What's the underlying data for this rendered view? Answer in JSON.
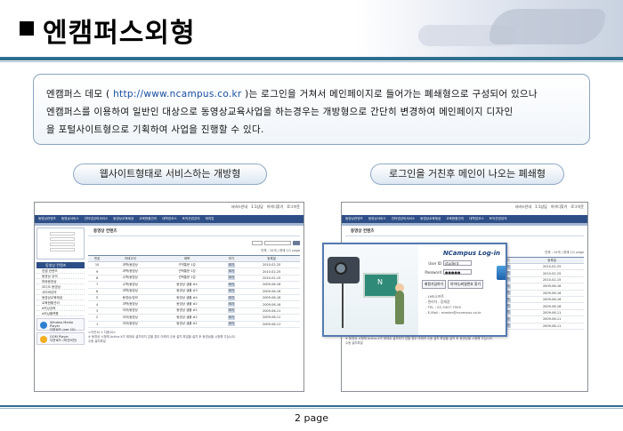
{
  "title": "엔캠퍼스외형",
  "description": {
    "line1_prefix": "엔캠퍼스 데모 ( ",
    "url": "http://www.ncampus.co.kr",
    "line1_suffix": " )는 로그인을 거쳐서 메인페이지로 들어가는 폐쇄형으로 구성되어 있으나",
    "line2": "엔캠퍼스를 이용하여 일반인 대상으로 동영상교육사업을 하는경우는 개방형으로 간단히 변경하여 메인페이지 디자인",
    "line3": "을 포털사이트형으로 기획하여 사업을 진행할 수 있다."
  },
  "labels": {
    "open_type": "웹사이트형태로 서비스하는 개방형",
    "closed_type": "로그인을 거친후 메인이 나오는 폐쇄형"
  },
  "mini_site": {
    "topbar": [
      "서비스안내",
      "1:1상담",
      "아이디찾기",
      "로그아웃"
    ],
    "gnb": [
      "동영상컨텐츠",
      "동영상서비스",
      "인터넷강의서비스",
      "동영상교육제공",
      "교육현황관리",
      "대학업코스",
      "토익관련강의",
      "캐치업"
    ],
    "menu_title": "동영상 컨텐츠",
    "content_title": "동영상 컨텐츠",
    "count_text": "전체 : 10개 | 현재 1/1 page",
    "menu_items": [
      "컨셉 컨텐츠",
      "동영상 강의",
      "파워동영상",
      "오디오 동영상",
      "사이버강의",
      "동영상교육제공",
      "교육현황관리",
      "e러닝강좌",
      "e러닝플랫폼"
    ],
    "players": [
      {
        "name": "Window Media Player",
        "sub": "다운로드 (ver 10)"
      },
      {
        "name": "GOM Player",
        "sub": "다운로드 (최신버전)"
      }
    ],
    "columns": [
      "번호",
      "카테고리",
      "제목",
      "보기",
      "등록일"
    ],
    "rows": [
      {
        "no": "10",
        "cat": "과학/동영상",
        "title": "구역통문 1강",
        "view": "보기",
        "date": "2010-02-25"
      },
      {
        "no": "9",
        "cat": "과학/동영상",
        "title": "선택통문 1강",
        "view": "보기",
        "date": "2010-02-25"
      },
      {
        "no": "8",
        "cat": "수학/동영상",
        "title": "선택통문 1강",
        "view": "보기",
        "date": "2010-02-15"
      },
      {
        "no": "7",
        "cat": "수학/동영상",
        "title": "동영상 샘플 #4",
        "view": "보기",
        "date": "2009-06-16"
      },
      {
        "no": "6",
        "cat": "과학/동영상",
        "title": "동영상 샘플 #3",
        "view": "보기",
        "date": "2009-06-16"
      },
      {
        "no": "5",
        "cat": "동영상/강좌",
        "title": "동영상 샘플 #4",
        "view": "보기",
        "date": "2009-06-16"
      },
      {
        "no": "4",
        "cat": "과학/동영상",
        "title": "동영상 샘플 #2",
        "view": "보기",
        "date": "2009-06-16"
      },
      {
        "no": "3",
        "cat": "국어/동영상",
        "title": "동영상 샘플 #1",
        "view": "보기",
        "date": "2009-06-11"
      },
      {
        "no": "2",
        "cat": "국어/동영상",
        "title": "동영상 샘플 #2",
        "view": "보기",
        "date": "2009-06-11"
      },
      {
        "no": "1",
        "cat": "국어/동영상",
        "title": "동영상 샘플 #1",
        "view": "보기",
        "date": "2009-06-11"
      }
    ],
    "pager": "<이전10 1 다음10>",
    "note": "※ 동영상 시청에 Active-X가 제대로 설치되지 않을 경우 아래의 수동 설치 파일을 설치 후 동영상을 시청해 주십시오.",
    "note_link": "수동 설치파일"
  },
  "login_popup": {
    "title": "NCampus Log-in",
    "id_label": "User ID",
    "id_value": "student",
    "pw_label": "Password",
    "pw_value": "●●●●●",
    "btn_join": "회원가입하기",
    "btn_find": "아이디/비밀번호 찾기",
    "info": [
      "- LMS소프트",
      "- 관리자 : 장재경",
      "- TEL : 02-3407-7500",
      "- E-Mail : master@ncampus.co.kr"
    ]
  },
  "page_number": "2 page"
}
